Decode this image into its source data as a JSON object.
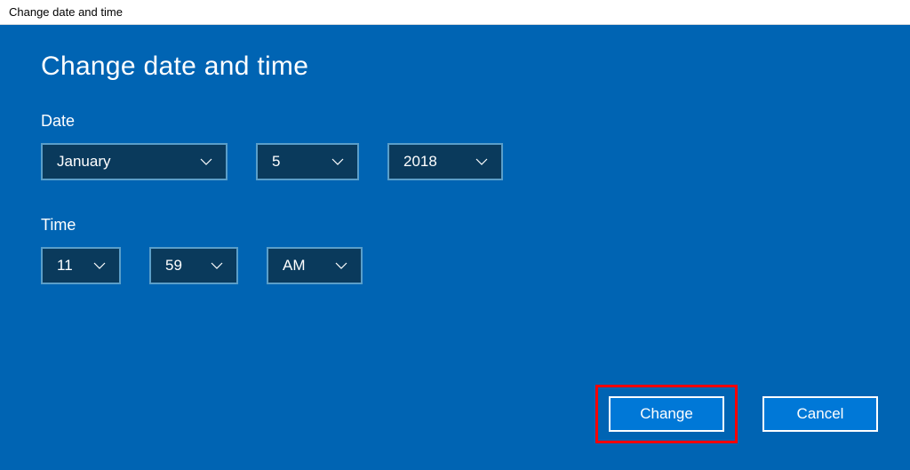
{
  "titlebar": "Change date and time",
  "heading": "Change date and time",
  "date": {
    "label": "Date",
    "month": "January",
    "day": "5",
    "year": "2018"
  },
  "time": {
    "label": "Time",
    "hour": "11",
    "minute": "59",
    "ampm": "AM"
  },
  "buttons": {
    "change": "Change",
    "cancel": "Cancel"
  },
  "colors": {
    "background": "#0064b3",
    "dropdown_bg": "#0a3a5c",
    "dropdown_border": "#5a9ec9",
    "button_bg": "#0078d7",
    "highlight": "#ff0000"
  }
}
